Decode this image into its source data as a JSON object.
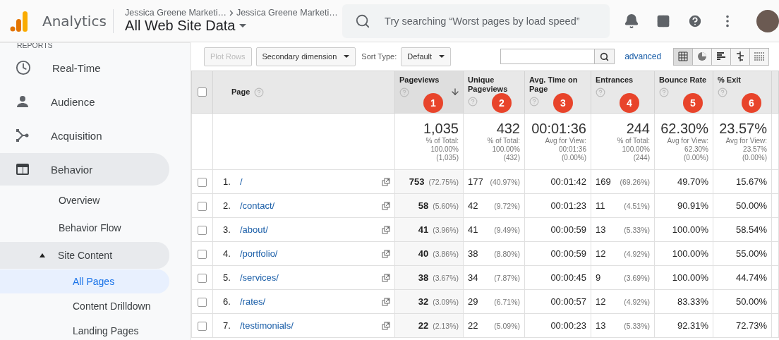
{
  "header": {
    "product": "Analytics",
    "breadcrumbs": [
      "Jessica Greene Marketi…",
      "Jessica Greene Marketi…"
    ],
    "view": "All Web Site Data",
    "search_placeholder": "Try searching “Worst pages by load speed”"
  },
  "sidebar": {
    "section": "REPORTS",
    "items": [
      {
        "label": "Real-Time",
        "expanded": false,
        "selected": false
      },
      {
        "label": "Audience",
        "expanded": false,
        "selected": false
      },
      {
        "label": "Acquisition",
        "expanded": false,
        "selected": false
      },
      {
        "label": "Behavior",
        "expanded": true,
        "selected": false,
        "children": [
          {
            "label": "Overview",
            "selected": false
          },
          {
            "label": "Behavior Flow",
            "selected": false
          },
          {
            "label": "Site Content",
            "selected": false,
            "expanded": true,
            "children": [
              {
                "label": "All Pages",
                "selected": true
              },
              {
                "label": "Content Drilldown",
                "selected": false
              },
              {
                "label": "Landing Pages",
                "selected": false
              }
            ]
          }
        ]
      }
    ]
  },
  "toolbar": {
    "plot_rows": {
      "label": "Plot Rows",
      "disabled": true
    },
    "secondary_dimension": "Secondary dimension",
    "sort_label": "Sort Type:",
    "sort_value": "Default",
    "advanced": "advanced",
    "views": [
      {
        "kind": "table",
        "selected": true
      },
      {
        "kind": "pie",
        "selected": false
      },
      {
        "kind": "bars",
        "selected": false
      },
      {
        "kind": "comparison",
        "selected": false
      },
      {
        "kind": "pivot",
        "selected": false
      }
    ]
  },
  "table": {
    "page_column": "Page",
    "select_all_checked": false,
    "columns": [
      {
        "label": "Pageviews",
        "badge": "1",
        "sorted": true
      },
      {
        "label": "Unique Pageviews",
        "badge": "2",
        "sorted": false
      },
      {
        "label": "Avg. Time on Page",
        "badge": "3",
        "sorted": false
      },
      {
        "label": "Entrances",
        "badge": "4",
        "sorted": false
      },
      {
        "label": "Bounce Rate",
        "badge": "5",
        "sorted": false
      },
      {
        "label": "% Exit",
        "badge": "6",
        "sorted": false
      }
    ],
    "totals": [
      {
        "value": "1,035",
        "note": "% of Total:\n100.00%\n(1,035)"
      },
      {
        "value": "432",
        "note": "% of Total:\n100.00%\n(432)"
      },
      {
        "value": "00:01:36",
        "note": "Avg for View:\n00:01:36\n(0.00%)"
      },
      {
        "value": "244",
        "note": "% of Total:\n100.00%\n(244)"
      },
      {
        "value": "62.30%",
        "note": "Avg for View:\n62.30%\n(0.00%)"
      },
      {
        "value": "23.57%",
        "note": "Avg for View:\n23.57%\n(0.00%)"
      }
    ],
    "rows": [
      {
        "index": "1.",
        "page": "/",
        "checked": false,
        "cells": [
          {
            "value": "753",
            "pct": "(72.75%)"
          },
          {
            "value": "177",
            "pct": "(40.97%)"
          },
          {
            "value": "00:01:42"
          },
          {
            "value": "169",
            "pct": "(69.26%)"
          },
          {
            "value": "49.70%"
          },
          {
            "value": "15.67%"
          }
        ]
      },
      {
        "index": "2.",
        "page": "/contact/",
        "checked": false,
        "cells": [
          {
            "value": "58",
            "pct": "(5.60%)"
          },
          {
            "value": "42",
            "pct": "(9.72%)"
          },
          {
            "value": "00:01:23"
          },
          {
            "value": "11",
            "pct": "(4.51%)"
          },
          {
            "value": "90.91%"
          },
          {
            "value": "50.00%"
          }
        ]
      },
      {
        "index": "3.",
        "page": "/about/",
        "checked": false,
        "cells": [
          {
            "value": "41",
            "pct": "(3.96%)"
          },
          {
            "value": "41",
            "pct": "(9.49%)"
          },
          {
            "value": "00:00:59"
          },
          {
            "value": "13",
            "pct": "(5.33%)"
          },
          {
            "value": "100.00%"
          },
          {
            "value": "58.54%"
          }
        ]
      },
      {
        "index": "4.",
        "page": "/portfolio/",
        "checked": false,
        "cells": [
          {
            "value": "40",
            "pct": "(3.86%)"
          },
          {
            "value": "38",
            "pct": "(8.80%)"
          },
          {
            "value": "00:00:59"
          },
          {
            "value": "12",
            "pct": "(4.92%)"
          },
          {
            "value": "100.00%"
          },
          {
            "value": "55.00%"
          }
        ]
      },
      {
        "index": "5.",
        "page": "/services/",
        "checked": false,
        "cells": [
          {
            "value": "38",
            "pct": "(3.67%)"
          },
          {
            "value": "34",
            "pct": "(7.87%)"
          },
          {
            "value": "00:00:45"
          },
          {
            "value": "9",
            "pct": "(3.69%)"
          },
          {
            "value": "100.00%"
          },
          {
            "value": "44.74%"
          }
        ]
      },
      {
        "index": "6.",
        "page": "/rates/",
        "checked": false,
        "cells": [
          {
            "value": "32",
            "pct": "(3.09%)"
          },
          {
            "value": "29",
            "pct": "(6.71%)"
          },
          {
            "value": "00:00:57"
          },
          {
            "value": "12",
            "pct": "(4.92%)"
          },
          {
            "value": "83.33%"
          },
          {
            "value": "50.00%"
          }
        ]
      },
      {
        "index": "7.",
        "page": "/testimonials/",
        "checked": false,
        "cells": [
          {
            "value": "22",
            "pct": "(2.13%)"
          },
          {
            "value": "22",
            "pct": "(5.09%)"
          },
          {
            "value": "00:00:23"
          },
          {
            "value": "13",
            "pct": "(5.33%)"
          },
          {
            "value": "92.31%"
          },
          {
            "value": "72.73%"
          }
        ]
      }
    ]
  }
}
